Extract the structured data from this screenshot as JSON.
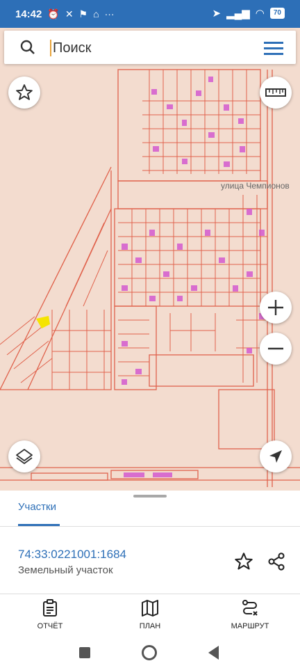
{
  "status_bar": {
    "time": "14:42",
    "battery": "70"
  },
  "search": {
    "placeholder": "Поиск"
  },
  "map": {
    "street_label": "улица Чемпионов"
  },
  "sheet": {
    "tab_label": "Участки",
    "parcel_id": "74:33:0221001:1684",
    "parcel_type": "Земельный участок"
  },
  "bottom_nav": [
    {
      "label": "ОТЧЁТ",
      "icon": "report-icon"
    },
    {
      "label": "ПЛАН",
      "icon": "map-plan-icon"
    },
    {
      "label": "МАРШРУТ",
      "icon": "route-icon"
    }
  ],
  "colors": {
    "accent": "#2d6fb7",
    "map_bg": "#f3dccf",
    "parcel_line": "#e0624c",
    "building": "#d45ad0",
    "highlight": "#f5e400"
  }
}
